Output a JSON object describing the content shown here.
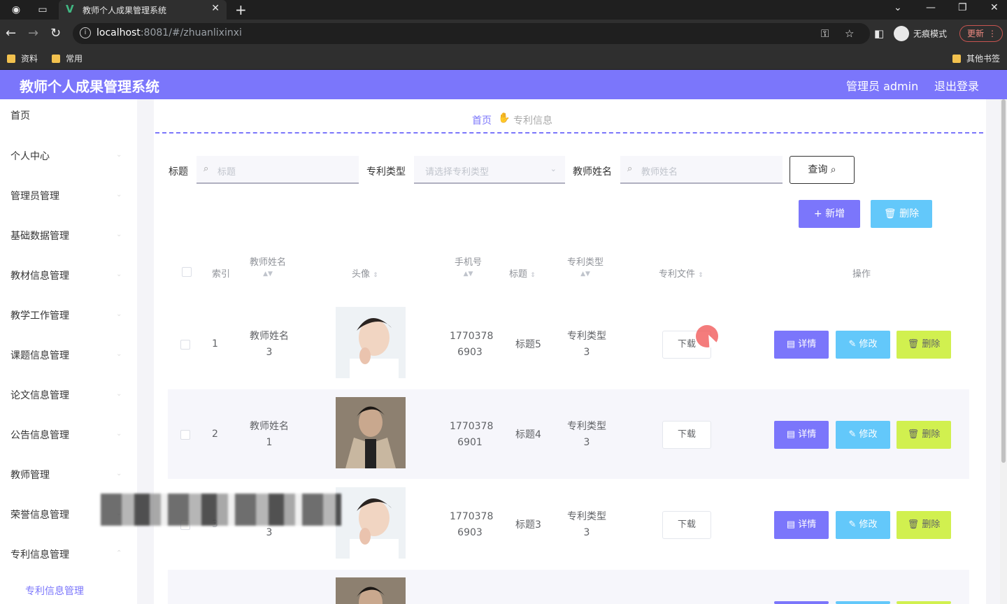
{
  "browser": {
    "tab_title": "教师个人成果管理系统",
    "url_host": "localhost",
    "url_rest": ":8081/#/zhuanlixinxi",
    "incognito_label": "无痕模式",
    "update_label": "更新",
    "bookmarks": [
      "资料",
      "常用"
    ],
    "other_bookmarks": "其他书签"
  },
  "app": {
    "title": "教师个人成果管理系统",
    "user": "管理员 admin",
    "logout": "退出登录"
  },
  "sidebar": {
    "items": [
      "首页",
      "个人中心",
      "管理员管理",
      "基础数据管理",
      "教材信息管理",
      "教学工作管理",
      "课题信息管理",
      "论文信息管理",
      "公告信息管理",
      "教师管理",
      "荣誉信息管理",
      "专利信息管理"
    ],
    "sub_item": "专利信息管理"
  },
  "breadcrumb": {
    "home": "首页",
    "current": "专利信息"
  },
  "filters": {
    "title_label": "标题",
    "title_placeholder": "标题",
    "type_label": "专利类型",
    "type_placeholder": "请选择专利类型",
    "teacher_label": "教师姓名",
    "teacher_placeholder": "教师姓名",
    "query_label": "查询"
  },
  "actions": {
    "add": "新增",
    "delete": "删除"
  },
  "table": {
    "headers": {
      "index": "索引",
      "teacher": "教师姓名",
      "avatar": "头像",
      "phone": "手机号",
      "title": "标题",
      "type": "专利类型",
      "file": "专利文件",
      "ops": "操作"
    },
    "download_label": "下载",
    "detail_label": "详情",
    "edit_label": "修改",
    "delete_label": "删除",
    "rows": [
      {
        "index": "1",
        "teacher_a": "教师姓名",
        "teacher_b": "3",
        "phone_a": "1770378",
        "phone_b": "6903",
        "title": "标题5",
        "type_a": "专利类型",
        "type_b": "3"
      },
      {
        "index": "2",
        "teacher_a": "教师姓名",
        "teacher_b": "1",
        "phone_a": "1770378",
        "phone_b": "6901",
        "title": "标题4",
        "type_a": "专利类型",
        "type_b": "3"
      },
      {
        "index": "3",
        "teacher_a": "",
        "teacher_b": "3",
        "phone_a": "1770378",
        "phone_b": "6903",
        "title": "标题3",
        "type_a": "专利类型",
        "type_b": "3"
      }
    ]
  }
}
